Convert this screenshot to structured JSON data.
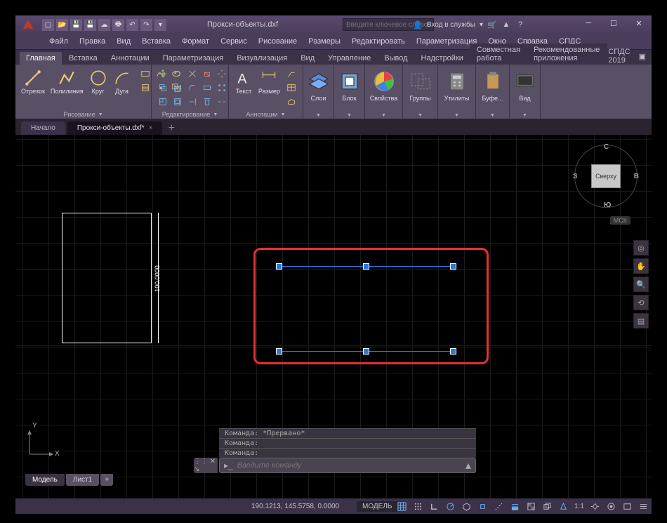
{
  "title": "Прокси-объекты.dxf",
  "search_placeholder": "Введите ключевое слово/фразу",
  "signin_label": "Вход в службы",
  "menu": [
    "Файл",
    "Правка",
    "Вид",
    "Вставка",
    "Формат",
    "Сервис",
    "Рисование",
    "Размеры",
    "Редактировать",
    "Параметризация",
    "Окно",
    "Справка",
    "СПДС"
  ],
  "ribbon_tabs": [
    "Главная",
    "Вставка",
    "Аннотации",
    "Параметризация",
    "Визуализация",
    "Вид",
    "Управление",
    "Вывод",
    "Надстройки",
    "Совместная работа",
    "Рекомендованные приложения"
  ],
  "ribbon_right": "СПДС 2019",
  "panels": {
    "draw": {
      "title": "Рисование",
      "line": "Отрезок",
      "pline": "Полилиния",
      "circle": "Круг",
      "arc": "Дуга"
    },
    "modify": {
      "title": "Редактирование"
    },
    "annot": {
      "title": "Аннотации",
      "text": "Текст",
      "dim": "Размер"
    },
    "layers": {
      "title": "Слои"
    },
    "block": {
      "title": "Блок"
    },
    "props": {
      "title": "Свойства"
    },
    "groups": {
      "title": "Группы"
    },
    "utils": {
      "title": "Утилиты"
    },
    "clip": {
      "title": "Буфе..."
    },
    "view": {
      "title": "Вид"
    }
  },
  "doctabs": {
    "home": "Начало",
    "active": "Прокси-объекты.dxf*"
  },
  "viewcube": {
    "face": "Сверху",
    "n": "С",
    "s": "Ю",
    "e": "В",
    "w": "З",
    "mck": "МСК"
  },
  "dim_text": "100.0000",
  "ucs": {
    "x": "X",
    "y": "Y"
  },
  "cmd": {
    "hist1": "Команда: *Прервано*",
    "hist2": "Команда:",
    "hist3": "Команда:",
    "placeholder": "Введите команду"
  },
  "laytabs": {
    "model": "Модель",
    "sheet1": "Лист1"
  },
  "status": {
    "coords": "190.1213, 145.5758, 0.0000",
    "model": "МОДЕЛЬ",
    "scale": "1:1"
  }
}
